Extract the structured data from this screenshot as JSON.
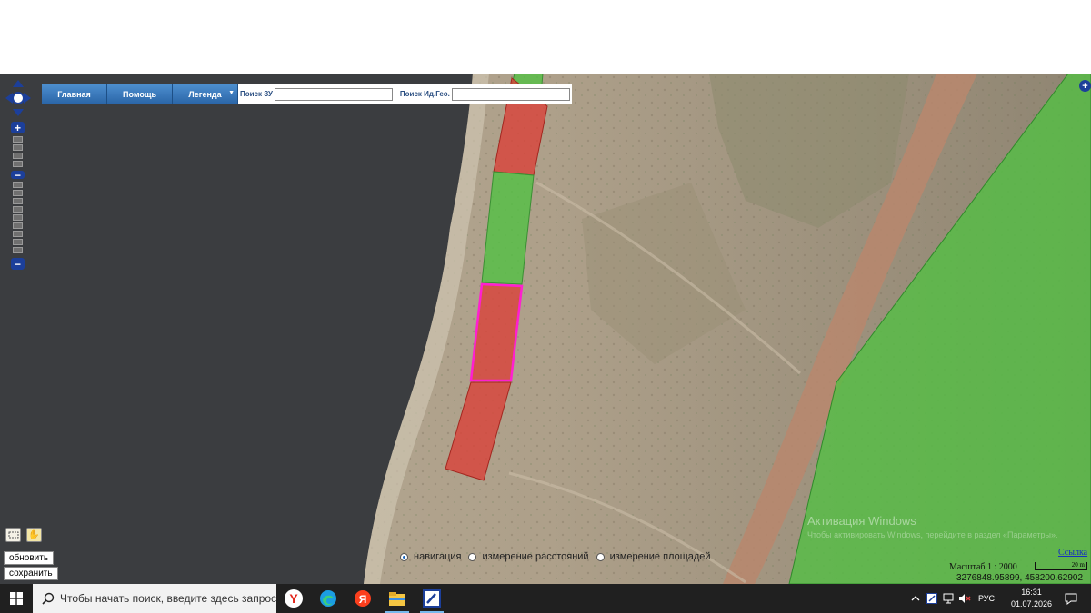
{
  "toolbar": {
    "main_label": "Главная",
    "help_label": "Помощь",
    "legend_label": "Легенда",
    "search_zu_label": "Поиск ЗУ",
    "search_zu_value": "",
    "search_geo_label": "Поиск Ид.Гео.",
    "search_geo_value": ""
  },
  "icons": {
    "nav": "pan-arrows-icon",
    "zoom_in": "plus-icon",
    "zoom_out": "minus-icon",
    "select": "select-tool-icon",
    "pan": "hand-icon",
    "start": "windows-icon",
    "search": "magnifier-icon"
  },
  "actions": {
    "refresh_label": "обновить",
    "save_label": "сохранить"
  },
  "modes": [
    {
      "label": "навигация",
      "selected": true
    },
    {
      "label": "измерение расстояний",
      "selected": false
    },
    {
      "label": "измерение площадей",
      "selected": false
    }
  ],
  "status": {
    "scale": "Масштаб 1 : 2000",
    "scale_bar": "20 m",
    "coords": "3276848.95899, 458200.62902",
    "link": "Ссылка"
  },
  "watermark": {
    "title": "Активация Windows",
    "subtitle": "Чтобы активировать Windows, перейдите в раздел «Параметры»."
  },
  "taskbar": {
    "search_placeholder": "Чтобы начать поиск, введите здесь запрос",
    "language": "РУС",
    "time": "16:31",
    "date": "01.07.2026"
  },
  "colors": {
    "parcel_red": "#d9423a",
    "parcel_green": "#52c043",
    "selection": "#ff1fd0",
    "water": "#3b3d40",
    "toolbar_blue": "#2b66a8"
  }
}
